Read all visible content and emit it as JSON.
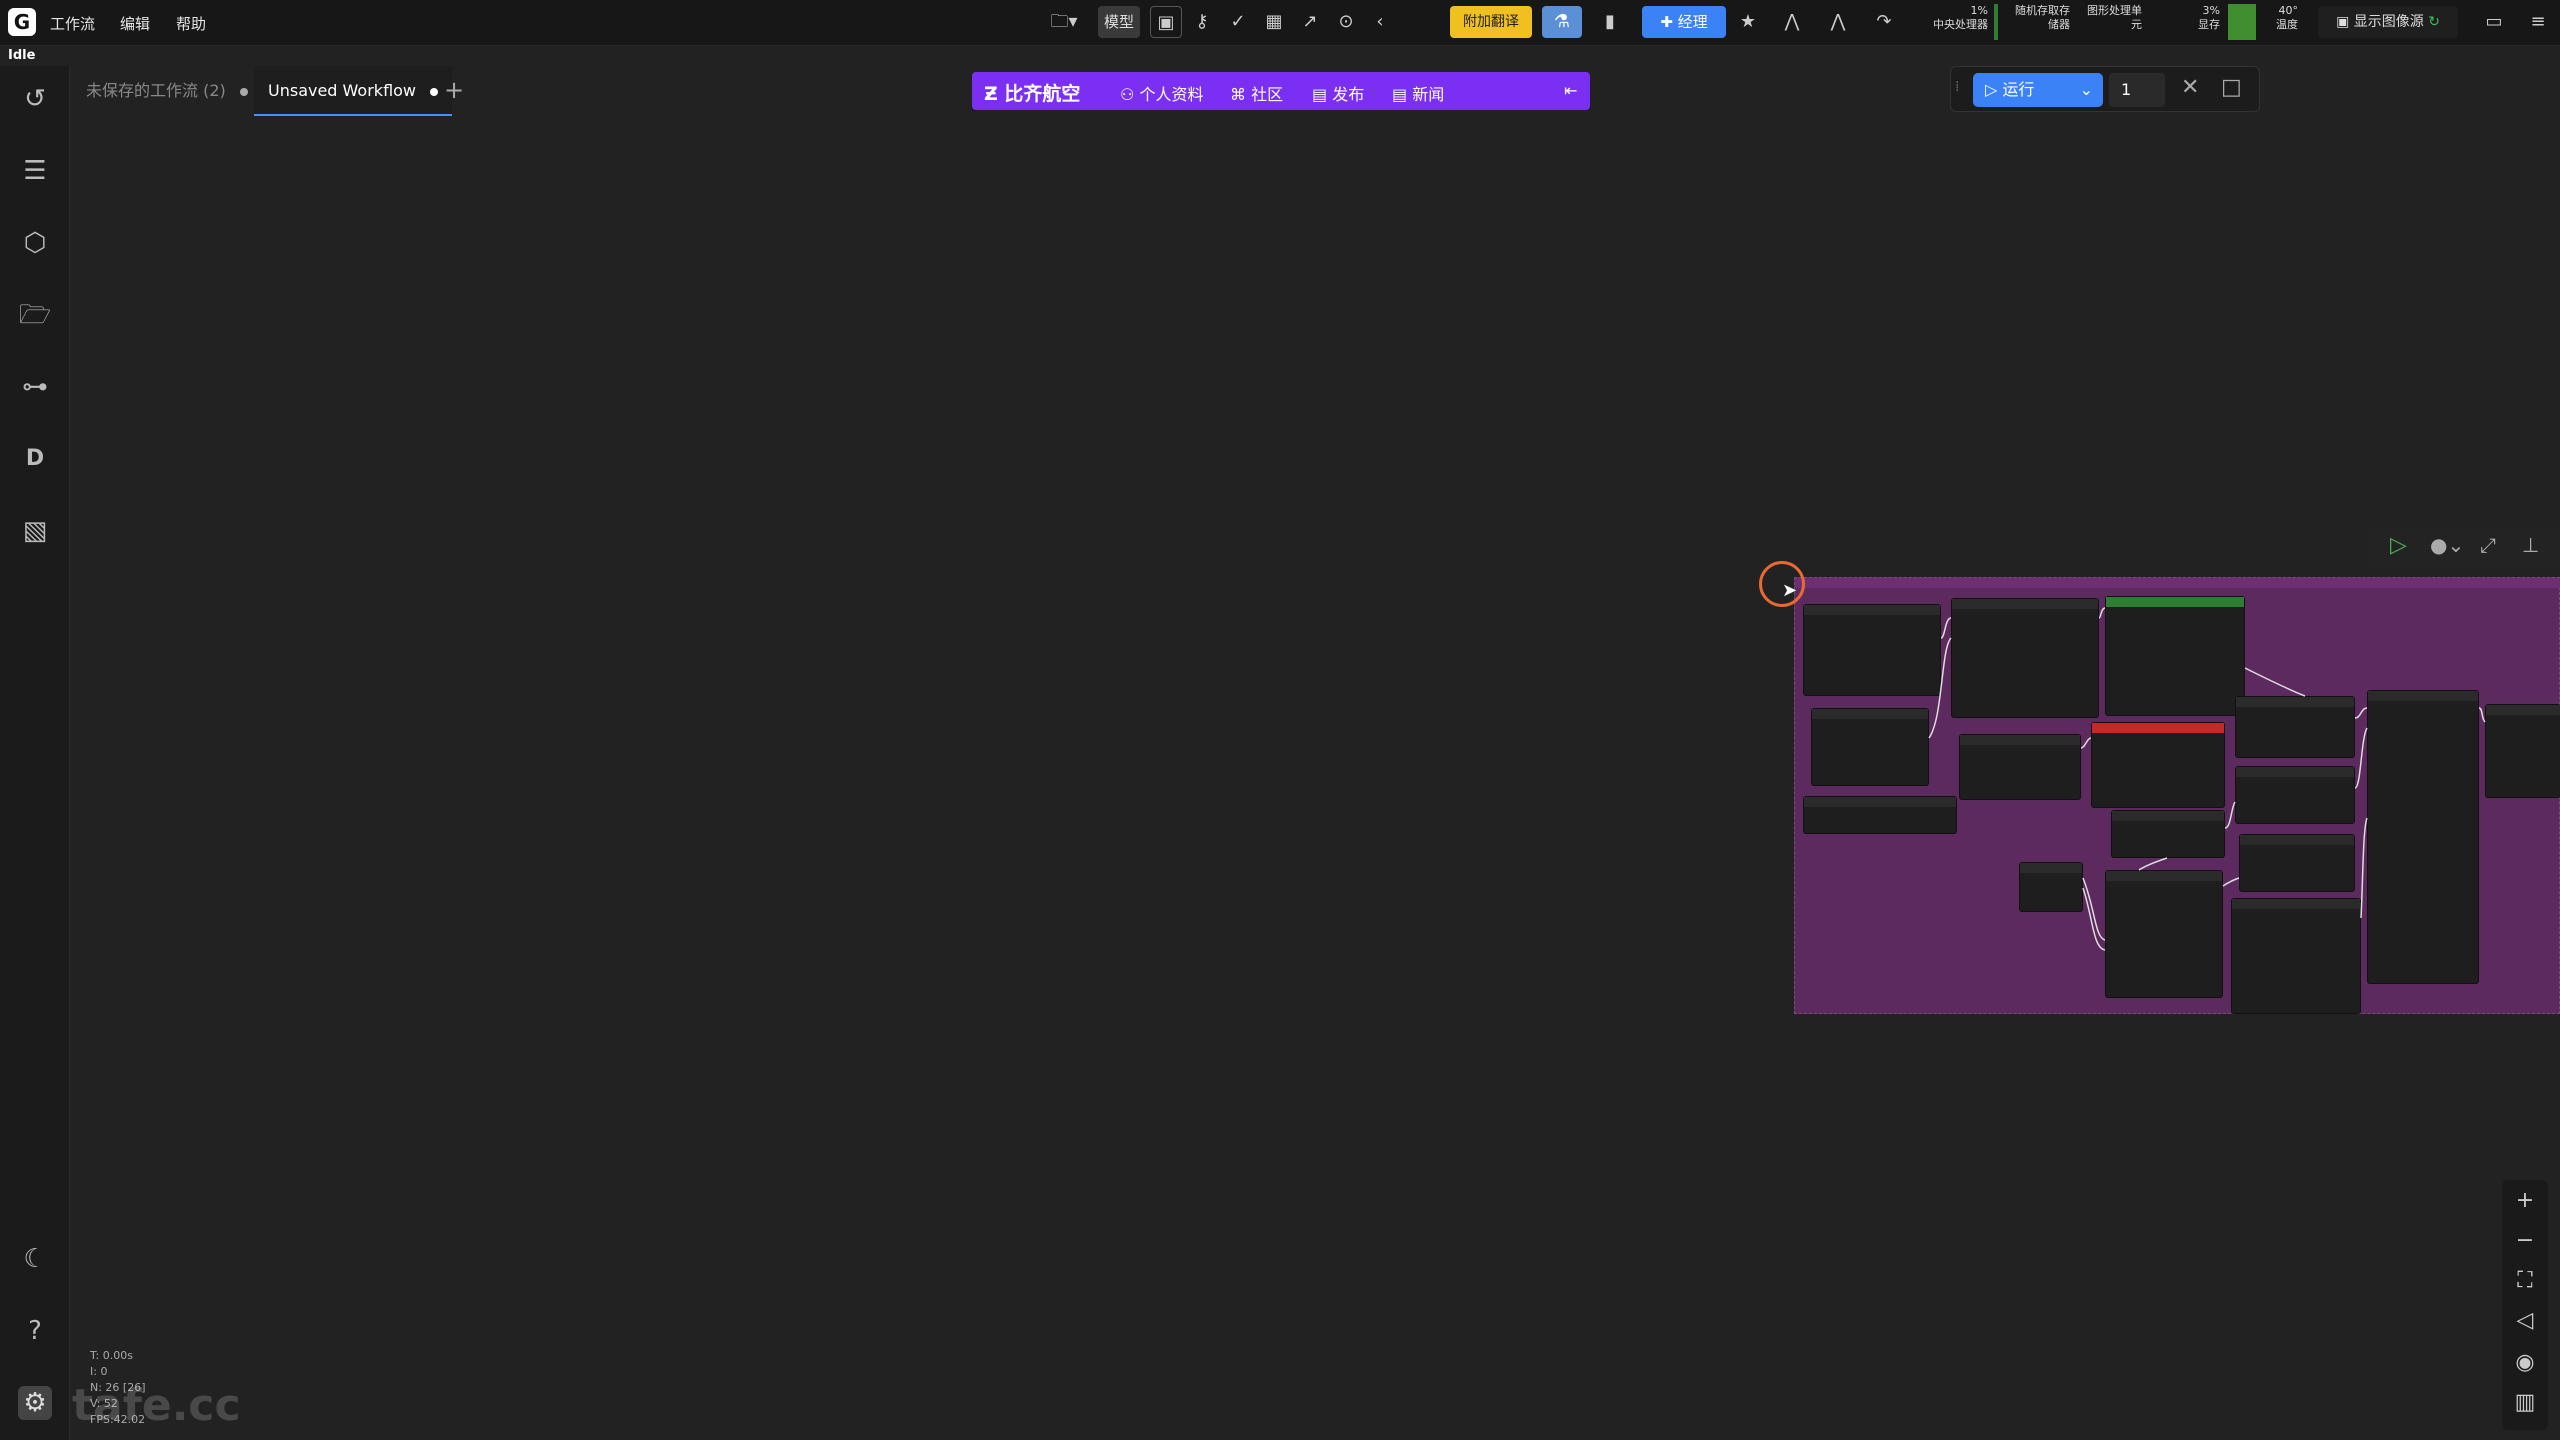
{
  "app": {
    "logo": "G",
    "status": "Idle"
  },
  "menubar": {
    "items": [
      "工作流",
      "编辑",
      "帮助"
    ]
  },
  "toolbar": {
    "model_label": "模型",
    "translate_label": "附加翻译",
    "manager_label": "经理",
    "show_image_source": "显示图像源",
    "stats": [
      {
        "value": "1%",
        "label": "中央处理器"
      },
      {
        "value": "随机存取存",
        "label": "储器"
      },
      {
        "value": "图形处理单",
        "label": "元"
      },
      {
        "value": "3%",
        "label": "显存"
      },
      {
        "value": "40°",
        "label": "温度"
      }
    ]
  },
  "tabs": [
    {
      "label": "未保存的工作流 (2)",
      "active": false
    },
    {
      "label": "Unsaved Workflow",
      "active": true
    }
  ],
  "banner": {
    "brand": "比齐航空",
    "links": [
      "个人资料",
      "社区",
      "发布",
      "新闻"
    ]
  },
  "runpanel": {
    "run_label": "运行",
    "count": "1"
  },
  "bottom_stats": [
    "T: 0.00s",
    "I: 0",
    "N: 26 [26]",
    "V: 52",
    "FPS:42.02"
  ],
  "watermark": "tafe.cc",
  "colors": {
    "accent": "#3b82f6",
    "banner": "#7b2ff2",
    "group": "#5c2a5e",
    "cursor": "#e86a32"
  }
}
